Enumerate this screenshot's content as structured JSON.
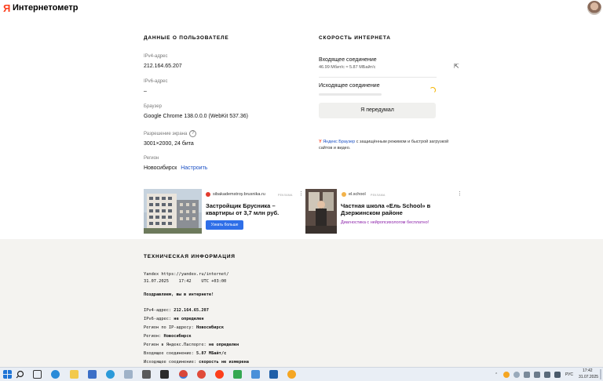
{
  "header": {
    "title": "Интернетометр",
    "logo": "Я"
  },
  "user": {
    "title": "ДАННЫЕ О ПОЛЬЗОВАТЕЛЕ",
    "ipv4_label": "IPv4-адрес",
    "ipv4_value": "212.164.65.207",
    "ipv6_label": "IPv6-адрес",
    "ipv6_value": "–",
    "browser_label": "Браузер",
    "browser_value": "Google Chrome 138.0.0.0 (WebKit 537.36)",
    "screen_label": "Разрешение экрана",
    "screen_value": "3001×2000, 24 бита",
    "region_label": "Регион",
    "region_value": "Новосибирск",
    "region_link": "Настроить"
  },
  "speed": {
    "title": "СКОРОСТЬ ИНТЕРНЕТА",
    "in_label": "Входящее соединение",
    "in_value": "46.99 Мбит/с  ≈  5.87 МБайт/с",
    "out_label": "Исходящее соединение",
    "button": "Я передумал",
    "promo_brand": "Яндекс Браузер",
    "promo_text": " с защищённым режимом и быстрой загрузкой сайтов и видео."
  },
  "ads": [
    {
      "domain": "sibakademstroy.brusnika.ru",
      "tag": "РЕКЛАМА",
      "title": "Застройщик Брусника – квартиры от 3,7 млн руб.",
      "button": "Узнать больше"
    },
    {
      "domain": "el.school",
      "tag": "РЕКЛАМА",
      "title": "Частная школа «Ель School» в Дзержинском районе",
      "desc": "Диагностика с нейропсихологом бесплатно!"
    }
  ],
  "tech": {
    "title": "ТЕХНИЧЕСКАЯ ИНФОРМАЦИЯ",
    "line1": "Yandex https://yandex.ru/internet/",
    "line2": "31.07.2025    17:42    UTC +03:00",
    "line3": "Поздравляем, вы в интернете!",
    "rows": [
      {
        "k": "IPv4-адрес: ",
        "v": "212.164.65.207"
      },
      {
        "k": "IPv6-адрес: ",
        "v": "не определен"
      },
      {
        "k": "Регион по IP-адресу: ",
        "v": "Новосибирск"
      },
      {
        "k": "Регион: ",
        "v": "Новосибирск"
      },
      {
        "k": "Регион в Яндекс.Паспорте: ",
        "v": "не определен"
      },
      {
        "k": "Входящее соединение: ",
        "v": "5.87 МБайт/с"
      },
      {
        "k": "Исходящее соединение: ",
        "v": "скорость не измерена"
      }
    ]
  },
  "taskbar": {
    "lang": "РУС",
    "time": "17:42",
    "date": "31.07.2025"
  },
  "colors": {
    "accent": "#fc3f1d",
    "link": "#1a4fc4",
    "button_ad": "#2f6fe8",
    "spinner": "#f5b400"
  }
}
